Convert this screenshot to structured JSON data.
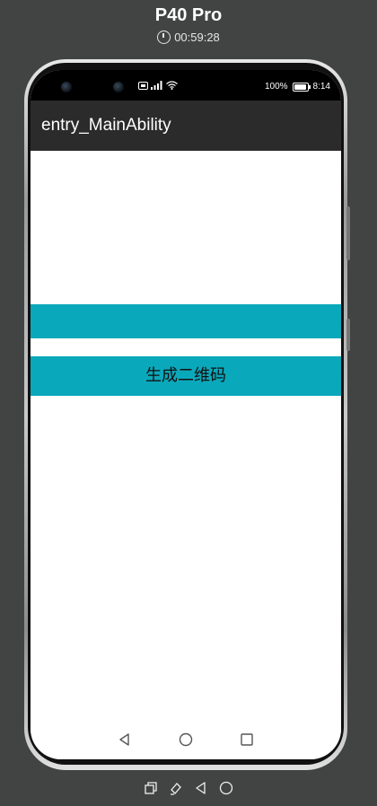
{
  "device": {
    "name": "P40 Pro",
    "timer": "00:59:28"
  },
  "statusbar": {
    "battery_text": "100%",
    "time": "8:14"
  },
  "app": {
    "title": "entry_MainAbility"
  },
  "main": {
    "button_top_label": "",
    "generate_qr_label": "生成二维码"
  },
  "colors": {
    "accent": "#0aa8bb",
    "appbar": "#2b2b2b",
    "background": "#ffffff"
  }
}
